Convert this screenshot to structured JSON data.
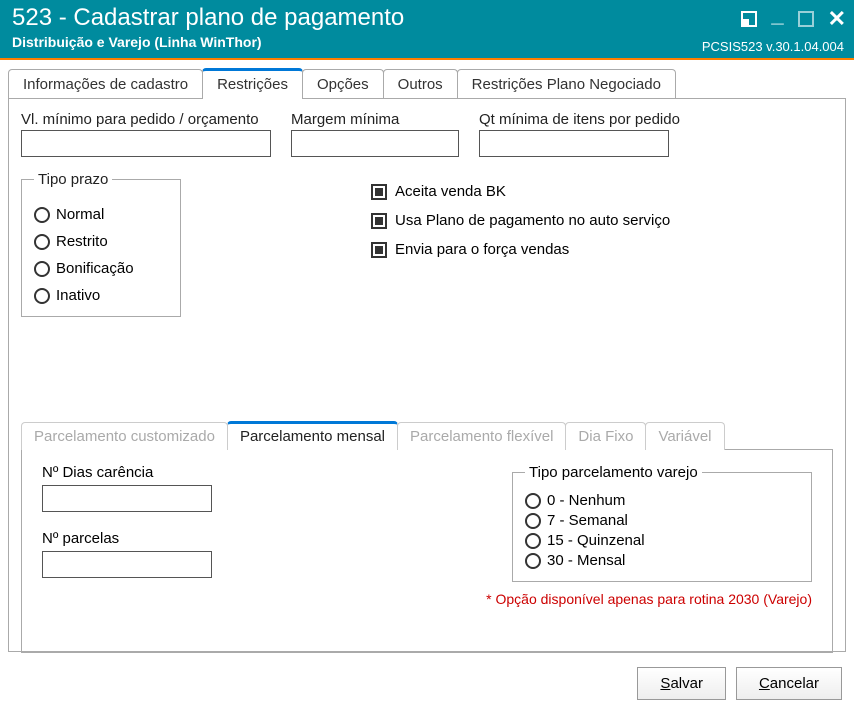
{
  "titlebar": {
    "title": "523 - Cadastrar plano de pagamento",
    "subtitle": "Distribuição e Varejo (Linha WinThor)",
    "version": "PCSIS523   v.30.1.04.004"
  },
  "tabs": {
    "info": "Informações de cadastro",
    "restricoes": "Restrições",
    "opcoes": "Opções",
    "outros": "Outros",
    "negociado": "Restrições Plano Negociado"
  },
  "fields": {
    "vl_label": "Vl. mínimo para pedido / orçamento",
    "vl_value": "",
    "margem_label": "Margem mínima",
    "margem_value": "",
    "qt_label": "Qt mínima de itens por pedido",
    "qt_value": ""
  },
  "tipo_prazo": {
    "legend": "Tipo prazo",
    "options": {
      "normal": "Normal",
      "restrito": "Restrito",
      "bonificacao": "Bonificação",
      "inativo": "Inativo"
    }
  },
  "checks": {
    "bk": "Aceita venda BK",
    "auto": "Usa Plano de pagamento no auto serviço",
    "forca": "Envia para o força vendas"
  },
  "subtabs": {
    "customizado": "Parcelamento customizado",
    "mensal": "Parcelamento mensal",
    "flexivel": "Parcelamento flexível",
    "diafixo": "Dia Fixo",
    "variavel": "Variável"
  },
  "mensal": {
    "dias_label": "Nº Dias carência",
    "dias_value": "",
    "parcelas_label": "Nº parcelas",
    "parcelas_value": ""
  },
  "tipo_parcelamento": {
    "legend": "Tipo parcelamento varejo",
    "options": {
      "nenhum": "0 - Nenhum",
      "semanal": "7 - Semanal",
      "quinzenal": "15 - Quinzenal",
      "mensal": "30 - Mensal"
    },
    "note": "* Opção disponível apenas para rotina 2030 (Varejo)"
  },
  "buttons": {
    "salvar": "Salvar",
    "cancelar": "Cancelar"
  }
}
